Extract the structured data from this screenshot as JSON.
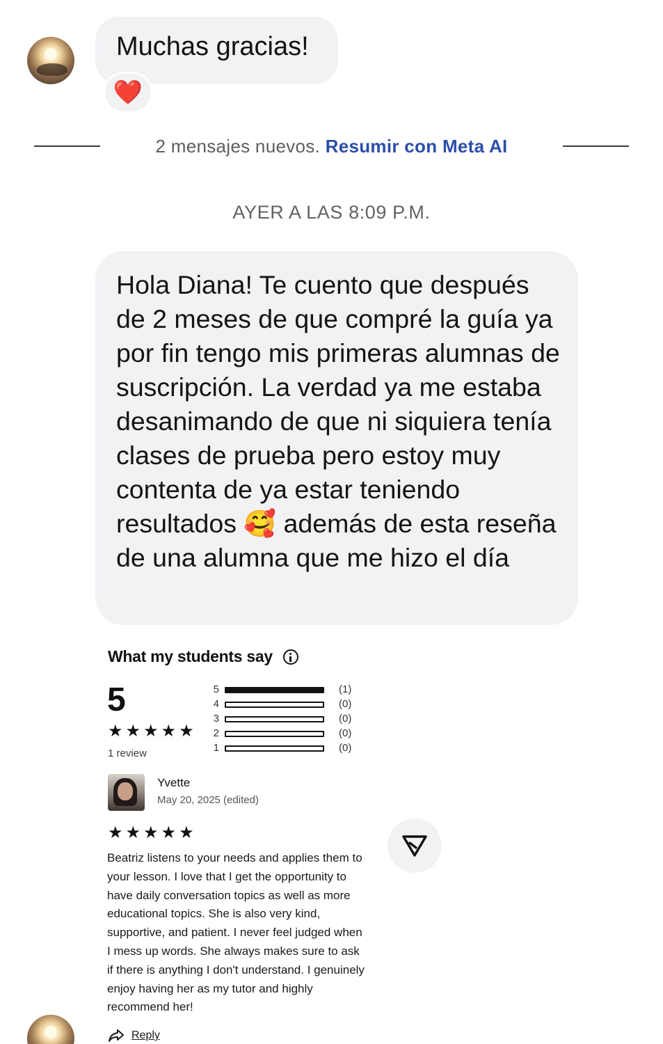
{
  "messages": {
    "first_message": "Muchas gracias!",
    "first_reaction": "❤️",
    "divider": {
      "text": "2 mensajes nuevos.",
      "link": "Resumir con Meta AI"
    },
    "timestamp": "AYER A LAS 8:09 P.M.",
    "second_message": "Hola Diana! Te cuento que después de 2 meses de que compré la guía ya por fin tengo mis primeras alumnas de suscripción. La verdad ya me estaba desanimando de que ni siquiera tenía clases de prueba pero estoy muy contenta de ya estar teniendo resultados 🥰 además de esta reseña de una alumna que me hizo el día"
  },
  "shared_screenshot": {
    "title": "What my students say",
    "overall_rating": "5",
    "stars": "★★★★★",
    "review_count": "1 review",
    "distribution": [
      {
        "stars": "5",
        "count": "(1)",
        "fraction": 1.0
      },
      {
        "stars": "4",
        "count": "(0)",
        "fraction": 0.0
      },
      {
        "stars": "3",
        "count": "(0)",
        "fraction": 0.0
      },
      {
        "stars": "2",
        "count": "(0)",
        "fraction": 0.0
      },
      {
        "stars": "1",
        "count": "(0)",
        "fraction": 0.0
      }
    ],
    "review": {
      "name": "Yvette",
      "date": "May 20, 2025 (edited)",
      "stars": "★★★★★",
      "text": "Beatriz listens to your needs and applies them to your lesson. I love that I get the opportunity to have daily conversation topics as well as more educational topics. She is also very kind, supportive, and patient. I never feel judged when I mess up words. She always makes sure to ask if there is anything I don't understand. I genuinely enjoy having her as my tutor and highly recommend her!",
      "reply_label": "Reply"
    }
  },
  "icons": {
    "send": "send-icon",
    "info": "info-icon",
    "reply": "reply-arrow-icon"
  }
}
